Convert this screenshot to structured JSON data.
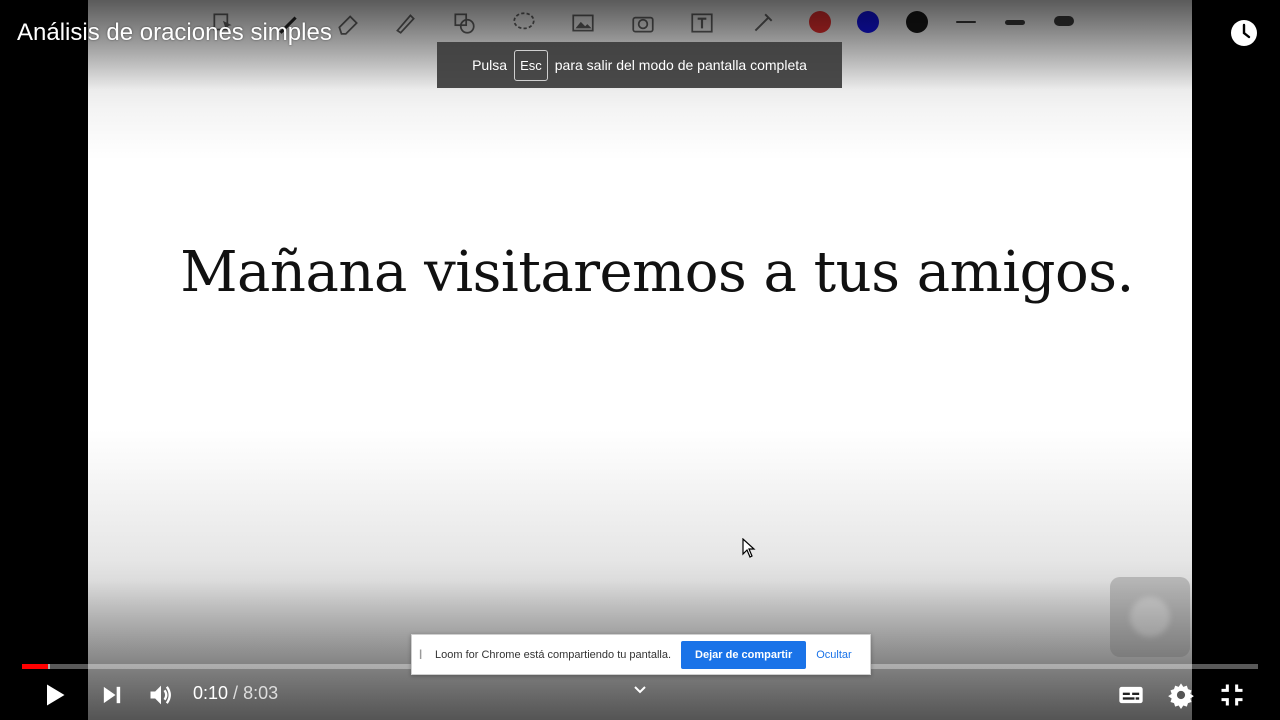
{
  "player": {
    "title": "Análisis de oraciones simples",
    "progress_fraction": 0.021,
    "buffered_fraction": 0.023,
    "time_current": "0:10",
    "time_separator": " / ",
    "time_duration": "8:03"
  },
  "fullscreen_notice": {
    "before": "Pulsa",
    "key": "Esc",
    "after": "para salir del modo de pantalla completa"
  },
  "slide": {
    "sentence": "Mañana visitaremos a tus amigos."
  },
  "annotation_toolbar": {
    "tools": [
      "select-icon",
      "pen-icon",
      "eraser-icon",
      "highlighter-icon",
      "shapes-icon",
      "lasso-icon",
      "image-icon",
      "camera-icon",
      "text-icon",
      "laser-icon"
    ],
    "colors": [
      "#d32f2f",
      "#1010c8",
      "#111111"
    ],
    "line_widths": [
      "thin",
      "medium",
      "thick"
    ]
  },
  "loom_bar": {
    "message": "Loom for Chrome está compartiendo tu pantalla.",
    "stop_label": "Dejar de compartir",
    "hide_label": "Ocultar",
    "handle": "||"
  }
}
